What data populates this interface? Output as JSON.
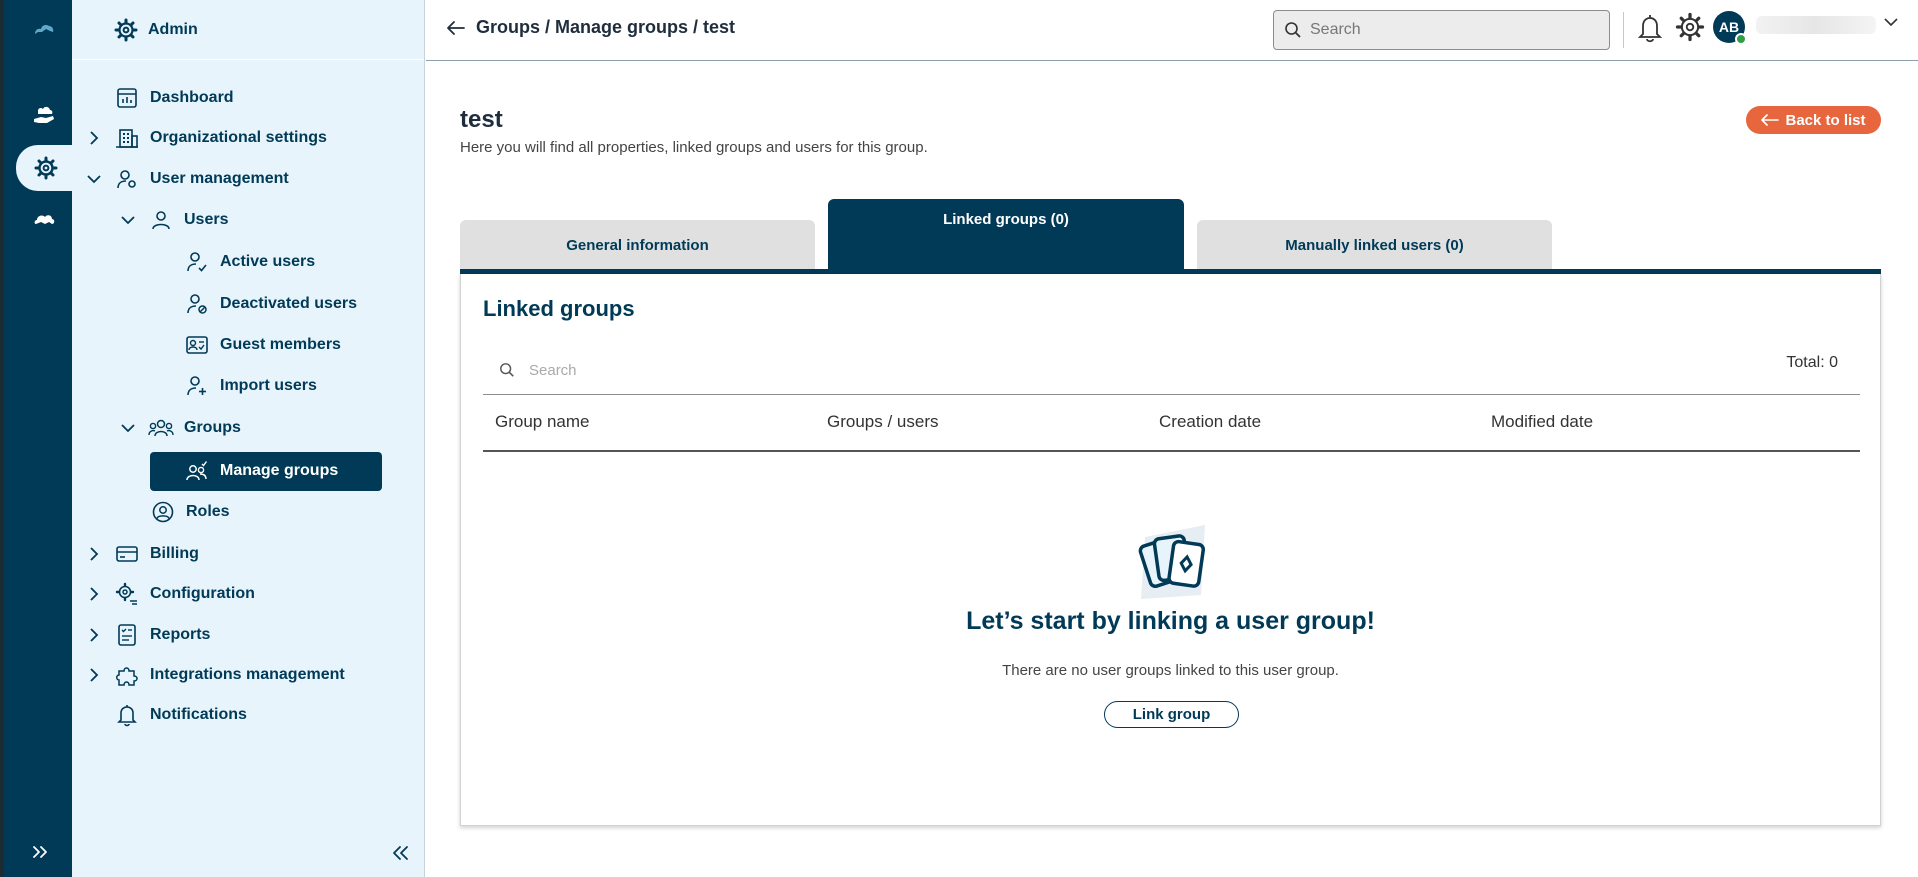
{
  "rail": {
    "items": [
      {
        "icon": "cloud-logo-icon"
      },
      {
        "icon": "hand-cloud-icon"
      },
      {
        "icon": "admin-gear-icon",
        "active": true
      },
      {
        "icon": "cloud-icon"
      }
    ],
    "expand_icon": "double-chevron-right-icon"
  },
  "sidebar": {
    "header": "Admin",
    "items": {
      "dashboard": "Dashboard",
      "org_settings": "Organizational settings",
      "user_management": "User management",
      "users": "Users",
      "active_users": "Active users",
      "deactivated_users": "Deactivated users",
      "guest_members": "Guest members",
      "import_users": "Import users",
      "groups": "Groups",
      "manage_groups": "Manage groups",
      "roles": "Roles",
      "billing": "Billing",
      "configuration": "Configuration",
      "reports": "Reports",
      "integrations": "Integrations management",
      "notifications": "Notifications"
    },
    "collapse_icon": "double-chevron-left-icon"
  },
  "topbar": {
    "breadcrumb": "Groups / Manage groups / test",
    "search_placeholder": "Search",
    "avatar_initials": "AB"
  },
  "page": {
    "title": "test",
    "subtitle": "Here you will find all properties, linked groups and users for this group.",
    "back_label": "Back to list"
  },
  "tabs": [
    {
      "label": "General information",
      "active": false
    },
    {
      "label": "Linked groups (0)",
      "active": true
    },
    {
      "label": "Manually linked users (0)",
      "active": false
    }
  ],
  "panel": {
    "title": "Linked groups",
    "search_placeholder": "Search",
    "total": "Total: 0",
    "columns": [
      "Group name",
      "Groups / users",
      "Creation date",
      "Modified date"
    ],
    "empty_title": "Let’s start by linking a user group!",
    "empty_text": "There are no user groups linked to this user group.",
    "link_button": "Link group"
  },
  "colors": {
    "brand_dark": "#003a57",
    "sidebar_bg": "#e8f4fb",
    "accent_orange": "#e8663d"
  }
}
